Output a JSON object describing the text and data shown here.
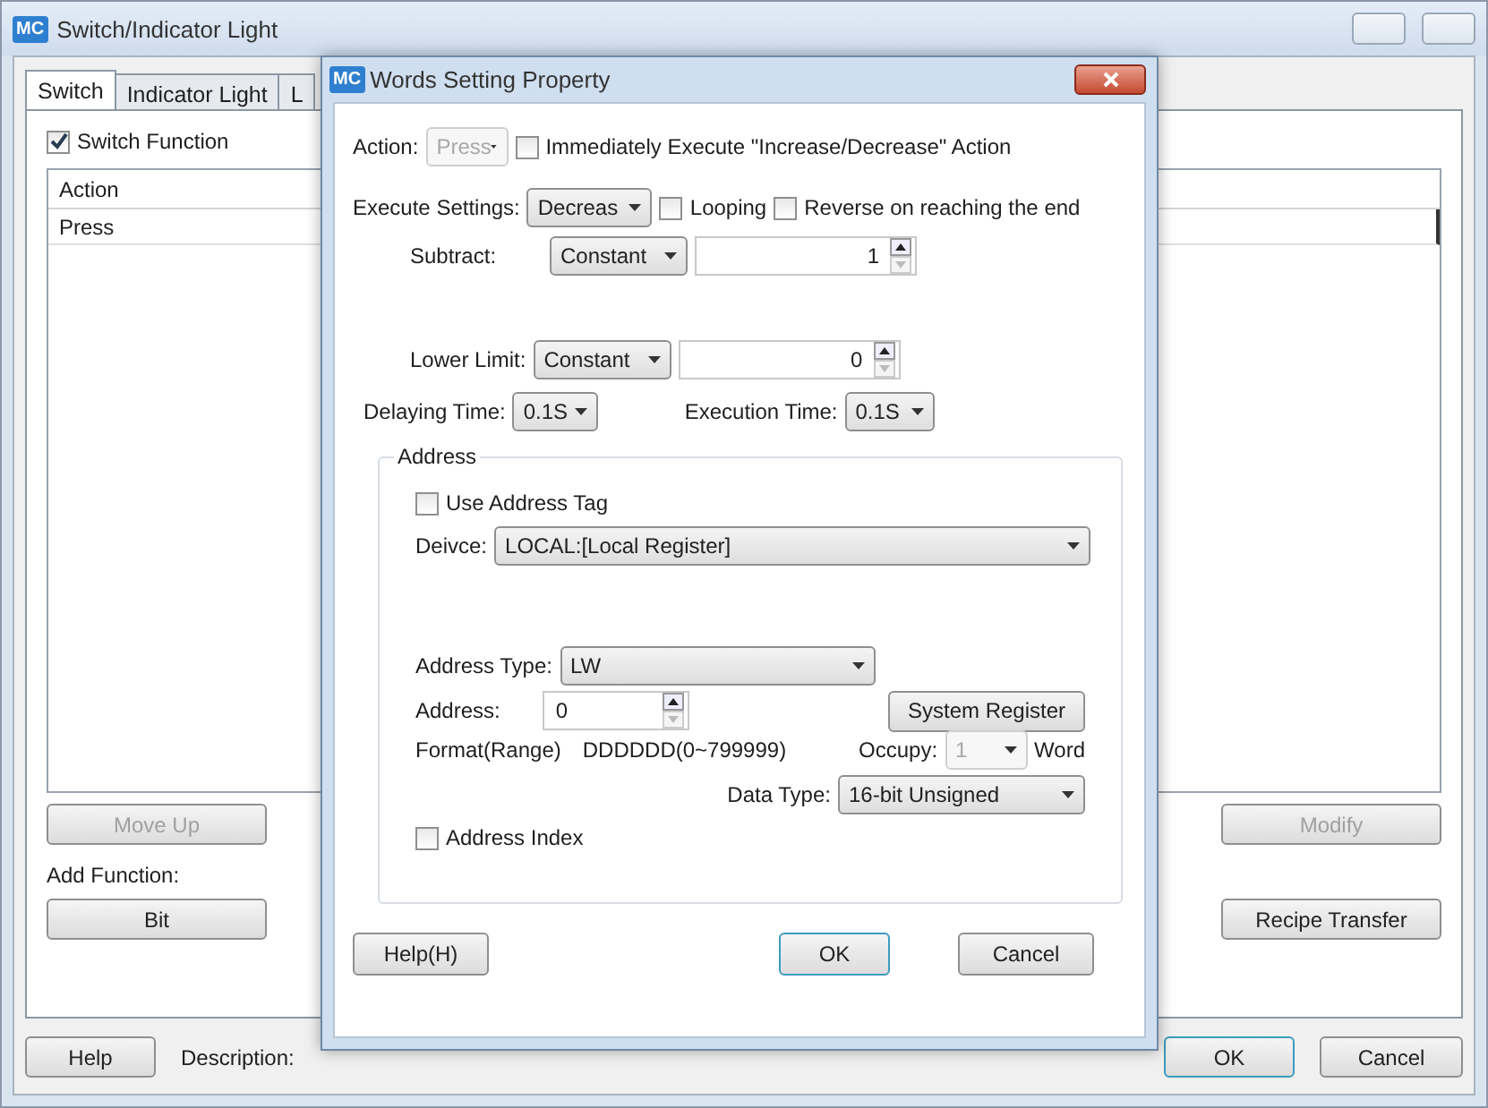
{
  "main_window": {
    "title": "Switch/Indicator Light",
    "logo": "MC",
    "tabs": [
      {
        "label": "Switch",
        "selected": true
      },
      {
        "label": "Indicator Light",
        "selected": false
      },
      {
        "label": "L",
        "selected": false
      }
    ],
    "switch_function": {
      "label": "Switch Function",
      "checked": true
    },
    "table": {
      "columns": [
        "Action"
      ],
      "rows": [
        [
          "Press"
        ]
      ]
    },
    "row_buttons": [
      {
        "label": "Move Up",
        "disabled": true
      },
      {
        "label": "Modify",
        "disabled": true
      }
    ],
    "add_function_label": "Add Function:",
    "function_buttons": [
      {
        "label": "Bit",
        "disabled": false
      },
      {
        "label": "Recipe Transfer",
        "disabled": false
      }
    ],
    "help_button": "Help",
    "description_label": "Description:",
    "ok_button": "OK",
    "cancel_button": "Cancel"
  },
  "dialog": {
    "title": "Words Setting Property",
    "logo": "MC",
    "action": {
      "label": "Action:",
      "value": "Press",
      "disabled": true
    },
    "immediately_execute": {
      "label": "Immediately Execute \"Increase/Decrease\" Action",
      "checked": false
    },
    "execute_settings": {
      "label": "Execute Settings:",
      "value": "Decreas",
      "disabled": false
    },
    "looping": {
      "label": "Looping",
      "checked": false
    },
    "reverse": {
      "label": "Reverse on reaching the end",
      "checked": false
    },
    "subtract": {
      "label": "Subtract:",
      "mode": "Constant",
      "value": "1"
    },
    "lower_limit": {
      "label": "Lower Limit:",
      "mode": "Constant",
      "value": "0"
    },
    "delaying_time": {
      "label": "Delaying Time:",
      "value": "0.1S"
    },
    "execution_time": {
      "label": "Execution Time:",
      "value": "0.1S"
    },
    "address": {
      "legend": "Address",
      "use_address_tag": {
        "label": "Use Address Tag",
        "checked": false
      },
      "device": {
        "label": "Deivce:",
        "value": "LOCAL:[Local Register]"
      },
      "address_type": {
        "label": "Address Type:",
        "value": "LW"
      },
      "address_field": {
        "label": "Address:",
        "value": "0"
      },
      "system_register_button": "System Register",
      "format_label": "Format(Range)",
      "format_value": "DDDDDD(0~799999)",
      "occupy": {
        "label": "Occupy:",
        "value": "1",
        "disabled": true
      },
      "occupy_unit": "Word",
      "data_type": {
        "label": "Data Type:",
        "value": "16-bit Unsigned"
      },
      "address_index": {
        "label": "Address Index",
        "checked": false
      }
    },
    "buttons": [
      {
        "label": "Help(H)",
        "default": false
      },
      {
        "label": "OK",
        "default": true
      },
      {
        "label": "Cancel",
        "default": false
      }
    ]
  }
}
